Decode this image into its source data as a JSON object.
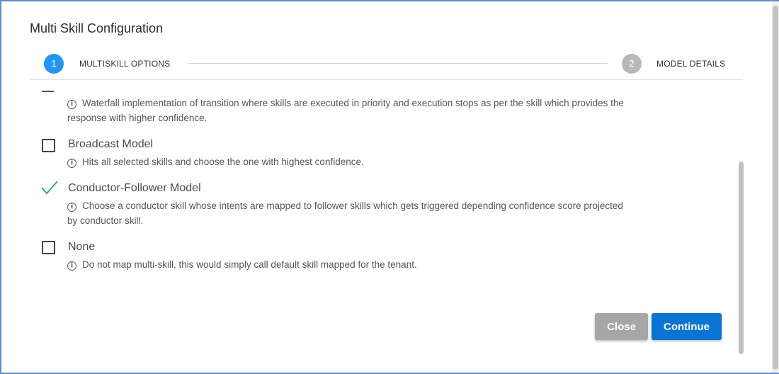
{
  "dialog": {
    "title": "Multi Skill Configuration"
  },
  "stepper": {
    "steps": [
      {
        "number": "1",
        "label": "MULTISKILL OPTIONS",
        "state": "active"
      },
      {
        "number": "2",
        "label": "MODEL DETAILS",
        "state": "inactive"
      }
    ]
  },
  "options": [
    {
      "label": "",
      "description": "Waterfall implementation of transition where skills are executed in priority and execution stops as per the skill which provides the response with higher confidence.",
      "checked": false
    },
    {
      "label": "Broadcast Model",
      "description": "Hits all selected skills and choose the one with highest confidence.",
      "checked": false
    },
    {
      "label": "Conductor-Follower Model",
      "description": "Choose a conductor skill whose intents are mapped to follower skills which gets triggered depending confidence score projected by conductor skill.",
      "checked": true
    },
    {
      "label": "None",
      "description": "Do not map multi-skill, this would simply call default skill mapped for the tenant.",
      "checked": false
    }
  ],
  "icons": {
    "info": "info-circle-icon",
    "check": "checkmark-icon"
  },
  "buttons": {
    "close": "Close",
    "continue": "Continue"
  },
  "colors": {
    "accent": "#2196f3",
    "primary_button": "#0a73d6",
    "close_button": "#a6a6a6",
    "check": "#26a69a"
  }
}
